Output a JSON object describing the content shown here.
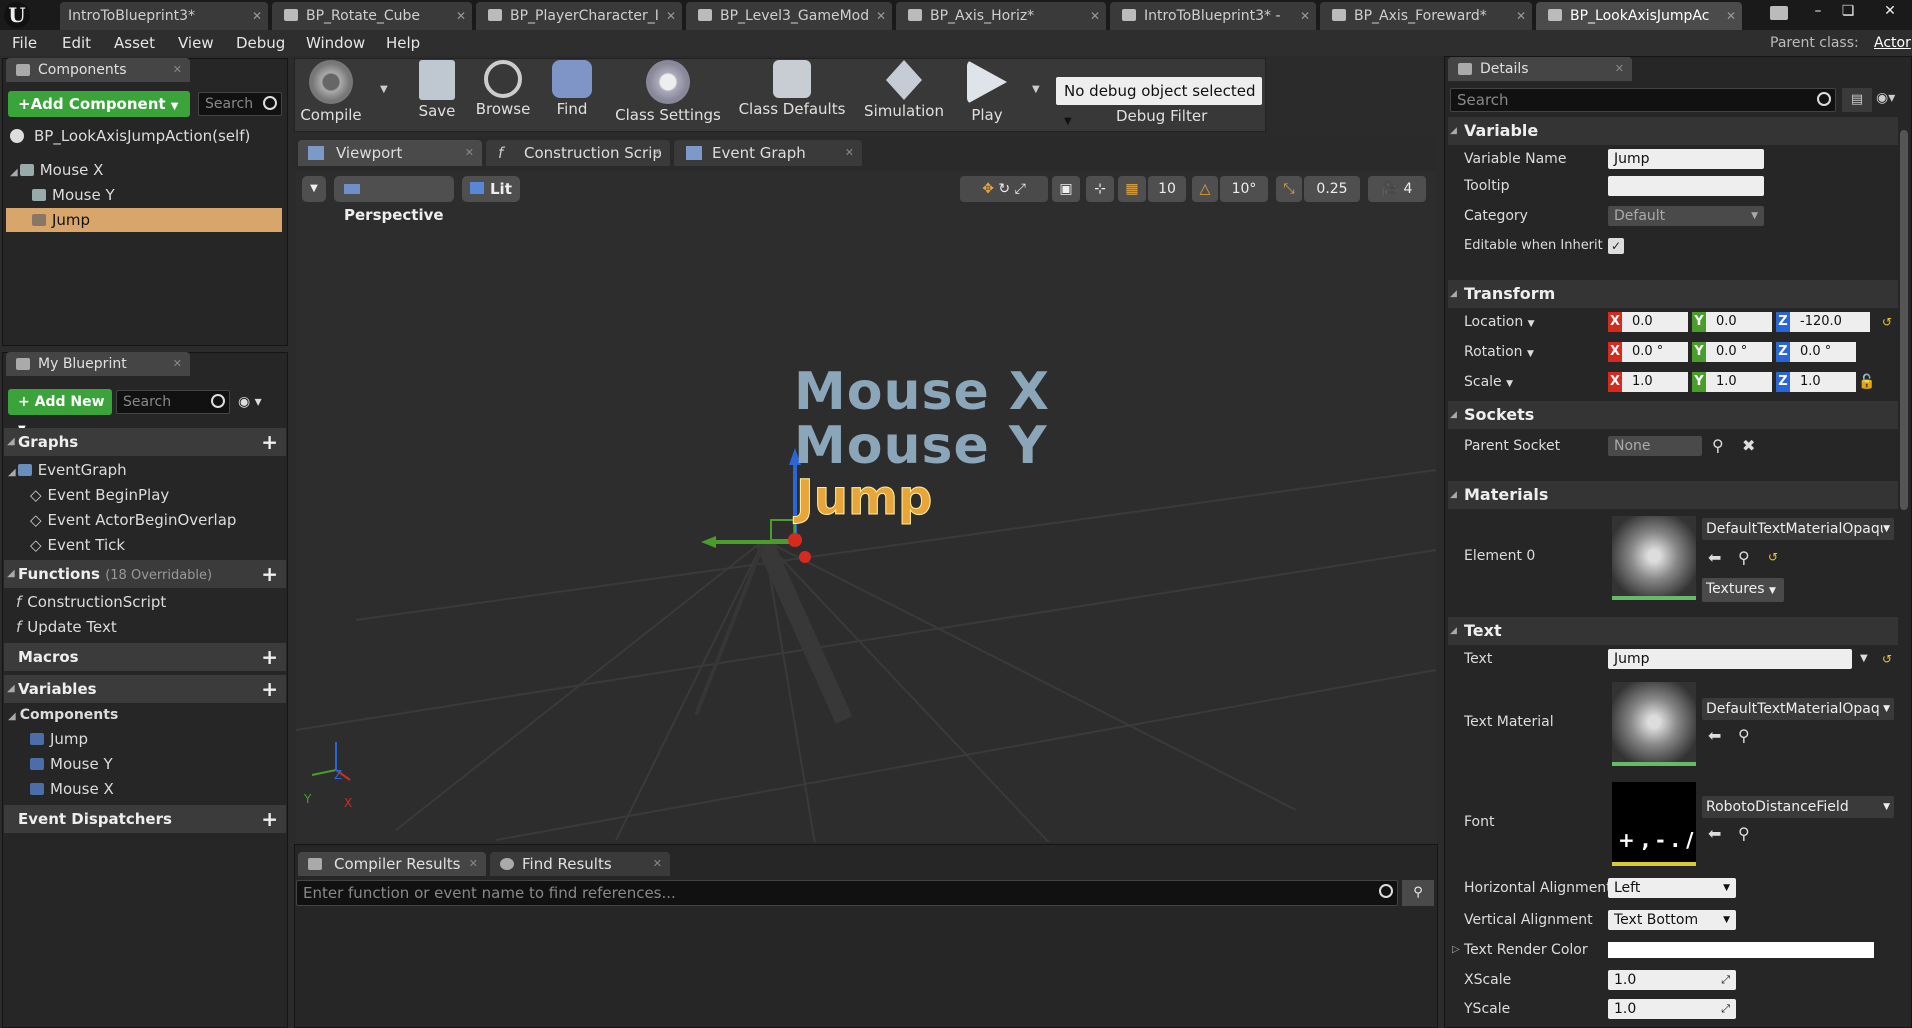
{
  "tabs": [
    {
      "label": "IntroToBlueprint3*"
    },
    {
      "label": "BP_Rotate_Cube"
    },
    {
      "label": "BP_PlayerCharacter_I"
    },
    {
      "label": "BP_Level3_GameMod"
    },
    {
      "label": "BP_Axis_Horiz*"
    },
    {
      "label": "IntroToBlueprint3* -"
    },
    {
      "label": "BP_Axis_Foreward*"
    },
    {
      "label": "BP_LookAxisJumpAc"
    }
  ],
  "window_controls": {
    "minimize": "–",
    "restore": "❏",
    "close": "✕"
  },
  "menu": [
    "File",
    "Edit",
    "Asset",
    "View",
    "Debug",
    "Window",
    "Help"
  ],
  "parent_class": {
    "label": "Parent class:",
    "value": "Actor"
  },
  "components": {
    "tab_label": "Components",
    "add_button": "+Add Component",
    "search_placeholder": "Search",
    "self_item": "BP_LookAxisJumpAction(self)",
    "items": [
      {
        "label": "Mouse X"
      },
      {
        "label": "Mouse Y"
      },
      {
        "label": "Jump"
      }
    ]
  },
  "toolbar": {
    "compile": "Compile",
    "save": "Save",
    "browse": "Browse",
    "find": "Find",
    "class_settings": "Class Settings",
    "class_defaults": "Class Defaults",
    "simulation": "Simulation",
    "play": "Play",
    "debug_select": "No debug object selected",
    "debug_filter": "Debug Filter"
  },
  "editor_tabs": [
    {
      "label": "Viewport"
    },
    {
      "label": "Construction Scrip"
    },
    {
      "label": "Event Graph"
    }
  ],
  "viewport": {
    "perspective": "Perspective",
    "lit": "Lit",
    "grid_snap": "10",
    "rot_snap": "10°",
    "scale_snap": "0.25",
    "cam_speed": "4",
    "text_mouse_x": "Mouse X",
    "text_mouse_y": "Mouse Y",
    "text_jump": "Jump",
    "axis_y": "Y",
    "axis_x": "X",
    "axis_z": "Z"
  },
  "my_blueprint": {
    "tab_label": "My Blueprint",
    "add_new": "Add New",
    "search_placeholder": "Search",
    "graphs_header": "Graphs",
    "event_graph": "EventGraph",
    "events": [
      {
        "label": "Event BeginPlay"
      },
      {
        "label": "Event ActorBeginOverlap"
      },
      {
        "label": "Event Tick"
      }
    ],
    "functions_header": "Functions",
    "functions_count": "(18 Overridable)",
    "functions": [
      {
        "label": "ConstructionScript"
      },
      {
        "label": "Update Text"
      }
    ],
    "macros_header": "Macros",
    "variables_header": "Variables",
    "components_sub": "Components",
    "variables": [
      {
        "label": "Jump"
      },
      {
        "label": "Mouse Y"
      },
      {
        "label": "Mouse X"
      }
    ],
    "event_dispatchers_header": "Event Dispatchers"
  },
  "bottom": {
    "compiler_results": "Compiler Results",
    "find_results": "Find Results",
    "find_placeholder": "Enter function or event name to find references..."
  },
  "details": {
    "tab_label": "Details",
    "search_placeholder": "Search",
    "variable_section": "Variable",
    "variable_name_label": "Variable Name",
    "variable_name_value": "Jump",
    "tooltip_label": "Tooltip",
    "tooltip_value": "",
    "category_label": "Category",
    "category_value": "Default",
    "editable_label": "Editable when Inherit",
    "editable_checked": true,
    "transform_section": "Transform",
    "location_label": "Location",
    "location": {
      "x": "0.0",
      "y": "0.0",
      "z": "-120.0"
    },
    "rotation_label": "Rotation",
    "rotation": {
      "x": "0.0 °",
      "y": "0.0 °",
      "z": "0.0 °"
    },
    "scale_label": "Scale",
    "scale": {
      "x": "1.0",
      "y": "1.0",
      "z": "1.0"
    },
    "sockets_section": "Sockets",
    "parent_socket_label": "Parent Socket",
    "parent_socket_value": "None",
    "materials_section": "Materials",
    "element0_label": "Element 0",
    "element0_value": "DefaultTextMaterialOpaqu",
    "textures_button": "Textures",
    "text_section": "Text",
    "text_label": "Text",
    "text_value": "Jump",
    "text_material_label": "Text Material",
    "text_material_value": "DefaultTextMaterialOpaq",
    "font_label": "Font",
    "font_value": "RobotoDistanceField",
    "font_thumb_text": "+ , - . /",
    "halign_label": "Horizontal Alignment",
    "halign_value": "Left",
    "valign_label": "Vertical Alignment",
    "valign_value": "Text Bottom",
    "render_color_label": "Text Render Color",
    "xscale_label": "XScale",
    "xscale_value": "1.0",
    "yscale_label": "YScale",
    "yscale_value": "1.0"
  },
  "colors": {
    "accent_green": "#3aa33a",
    "selected_row": "#d8a66a",
    "text_jump": "#e8a53a",
    "text_mouse": "#8aa6b8",
    "axis_red": "#d52b1e",
    "axis_green": "#4a9d2a",
    "axis_blue": "#2a66d6"
  }
}
